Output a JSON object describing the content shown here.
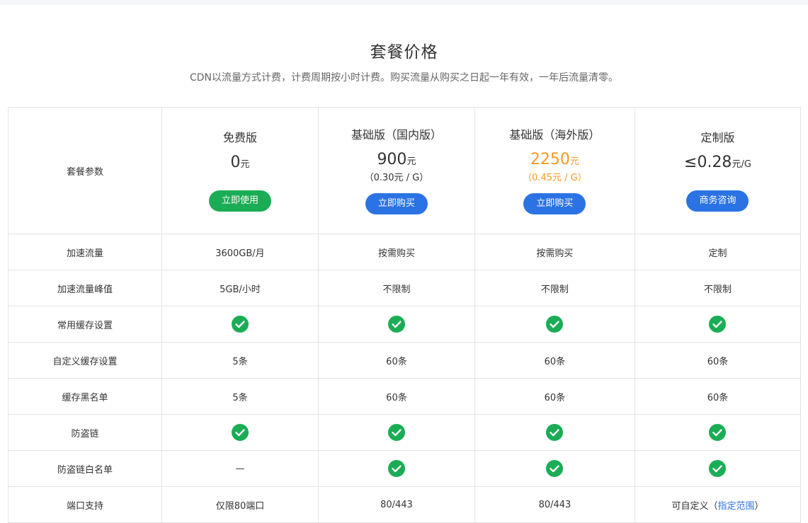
{
  "header": {
    "title": "套餐价格",
    "subtitle": "CDN以流量方式计费，计费周期按小时计费。购买流量从购买之日起一年有效，一年后流量清零。"
  },
  "colors": {
    "green_button": "#1aad55",
    "blue_button": "#2b73e4",
    "orange_price": "#f59a23",
    "check_green": "#1aad55"
  },
  "table": {
    "param_header": "套餐参数",
    "plans": [
      {
        "name": "免费版",
        "price": "0",
        "unit": "元",
        "per_unit": "",
        "button": "立即使用"
      },
      {
        "name": "基础版（国内版）",
        "price": "900",
        "unit": "元",
        "per_unit": "（0.30元 / G）",
        "button": "立即购买"
      },
      {
        "name": "基础版（海外版）",
        "price": "2250",
        "unit": "元",
        "per_unit": "（0.45元 / G）",
        "button": "立即购买"
      },
      {
        "name": "定制版",
        "price": "≤0.28",
        "unit": "元/G",
        "per_unit": "",
        "button": "商务咨询"
      }
    ],
    "rows": [
      {
        "label": "加速流量",
        "values": [
          "3600GB/月",
          "按需购买",
          "按需购买",
          "定制"
        ]
      },
      {
        "label": "加速流量峰值",
        "values": [
          "5GB/小时",
          "不限制",
          "不限制",
          "不限制"
        ]
      },
      {
        "label": "常用缓存设置",
        "values": [
          "check-icon",
          "check-icon",
          "check-icon",
          "check-icon"
        ]
      },
      {
        "label": "自定义缓存设置",
        "values": [
          "5条",
          "60条",
          "60条",
          "60条"
        ]
      },
      {
        "label": "缓存黑名单",
        "values": [
          "5条",
          "60条",
          "60条",
          "60条"
        ]
      },
      {
        "label": "防盗链",
        "values": [
          "check-icon",
          "check-icon",
          "check-icon",
          "check-icon"
        ]
      },
      {
        "label": "防盗链白名单",
        "values": [
          "—",
          "check-icon",
          "check-icon",
          "check-icon"
        ]
      },
      {
        "label": "端口支持",
        "values": [
          "仅限80端口",
          "80/443",
          "80/443",
          "可自定义（"
        ],
        "link": "指定范围",
        "link_suffix": "）"
      }
    ]
  }
}
